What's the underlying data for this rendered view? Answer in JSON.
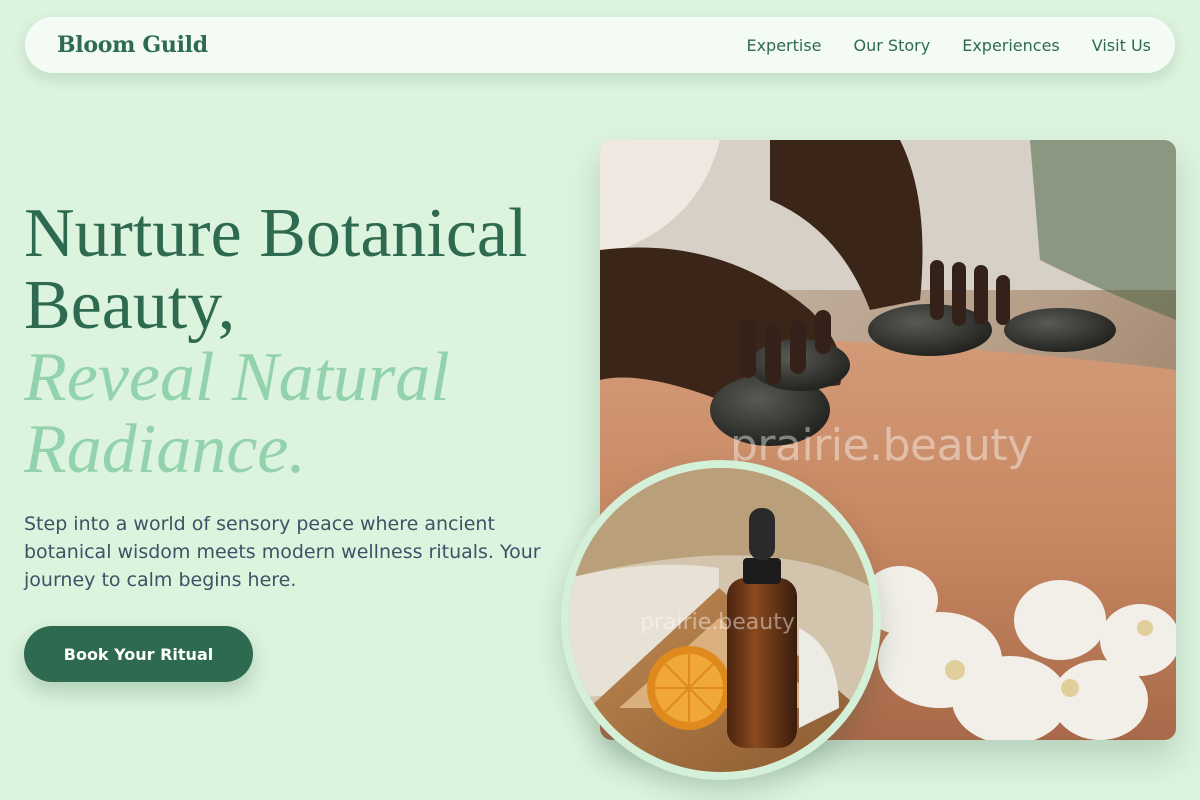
{
  "brand": {
    "name": "Bloom Guild"
  },
  "nav": {
    "links": [
      "Expertise",
      "Our Story",
      "Experiences",
      "Visit Us"
    ]
  },
  "hero": {
    "title_line1": "Nurture Botanical",
    "title_line2": "Beauty,",
    "accent_line1": "Reveal Natural",
    "accent_line2": "Radiance.",
    "description": "Step into a world of sensory peace where ancient botanical wisdom meets modern wellness rituals. Your journey to calm begins here.",
    "cta_label": "Book Your Ritual"
  },
  "images": {
    "main_watermark": "prairie.beauty",
    "inset_watermark": "prairie.beauty"
  },
  "colors": {
    "background": "#dcf3de",
    "primary": "#2e6a4f",
    "accent": "#92d2ad"
  }
}
